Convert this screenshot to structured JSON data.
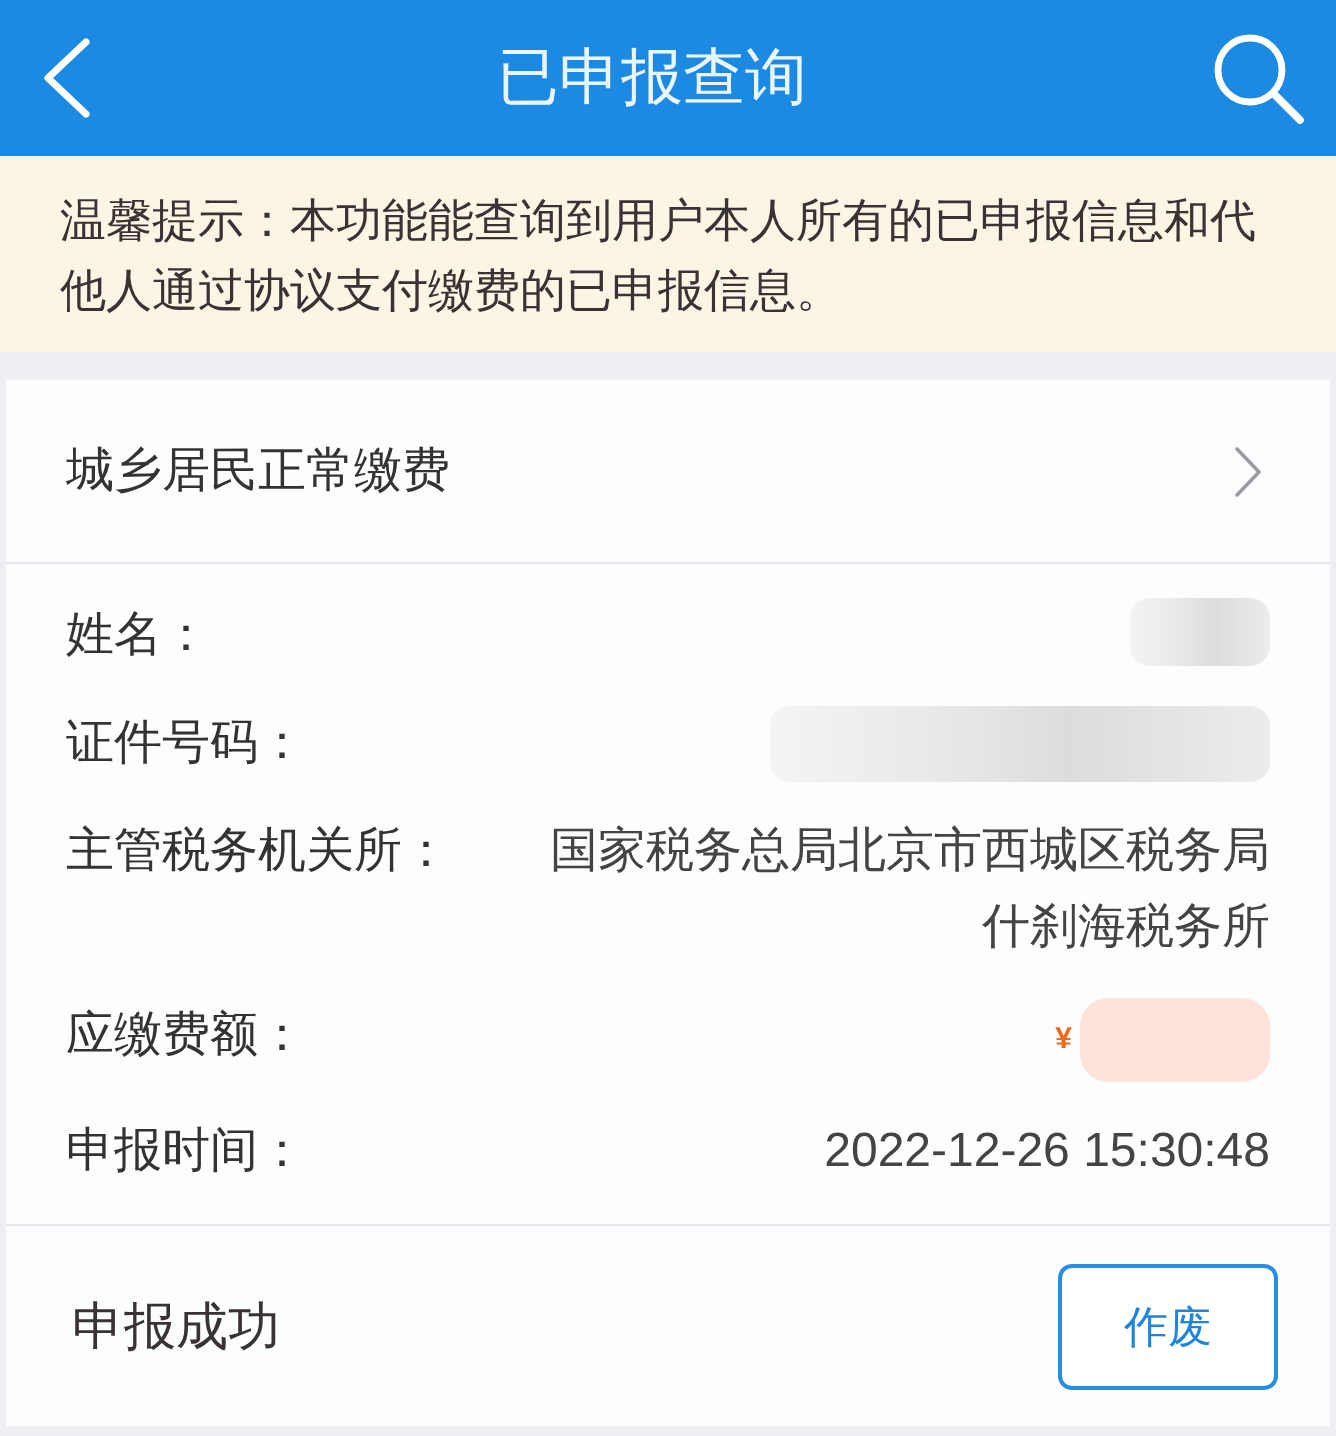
{
  "header": {
    "title": "已申报查询"
  },
  "notice": {
    "text": "温馨提示：本功能能查询到用户本人所有的已申报信息和代他人通过协议支付缴费的已申报信息。"
  },
  "record": {
    "category": "城乡居民正常缴费",
    "fields": [
      {
        "label": "姓名：",
        "kind": "redacted"
      },
      {
        "label": "证件号码：",
        "kind": "redacted"
      },
      {
        "label": "主管税务机关所：",
        "kind": "text",
        "value": "国家税务总局北京市西城区税务局什刹海税务所"
      },
      {
        "label": "应缴费额：",
        "kind": "amount",
        "currency": "¥"
      },
      {
        "label": "申报时间：",
        "kind": "text",
        "value": "2022-12-26 15:30:48"
      }
    ],
    "status": "申报成功",
    "action": "作废"
  }
}
